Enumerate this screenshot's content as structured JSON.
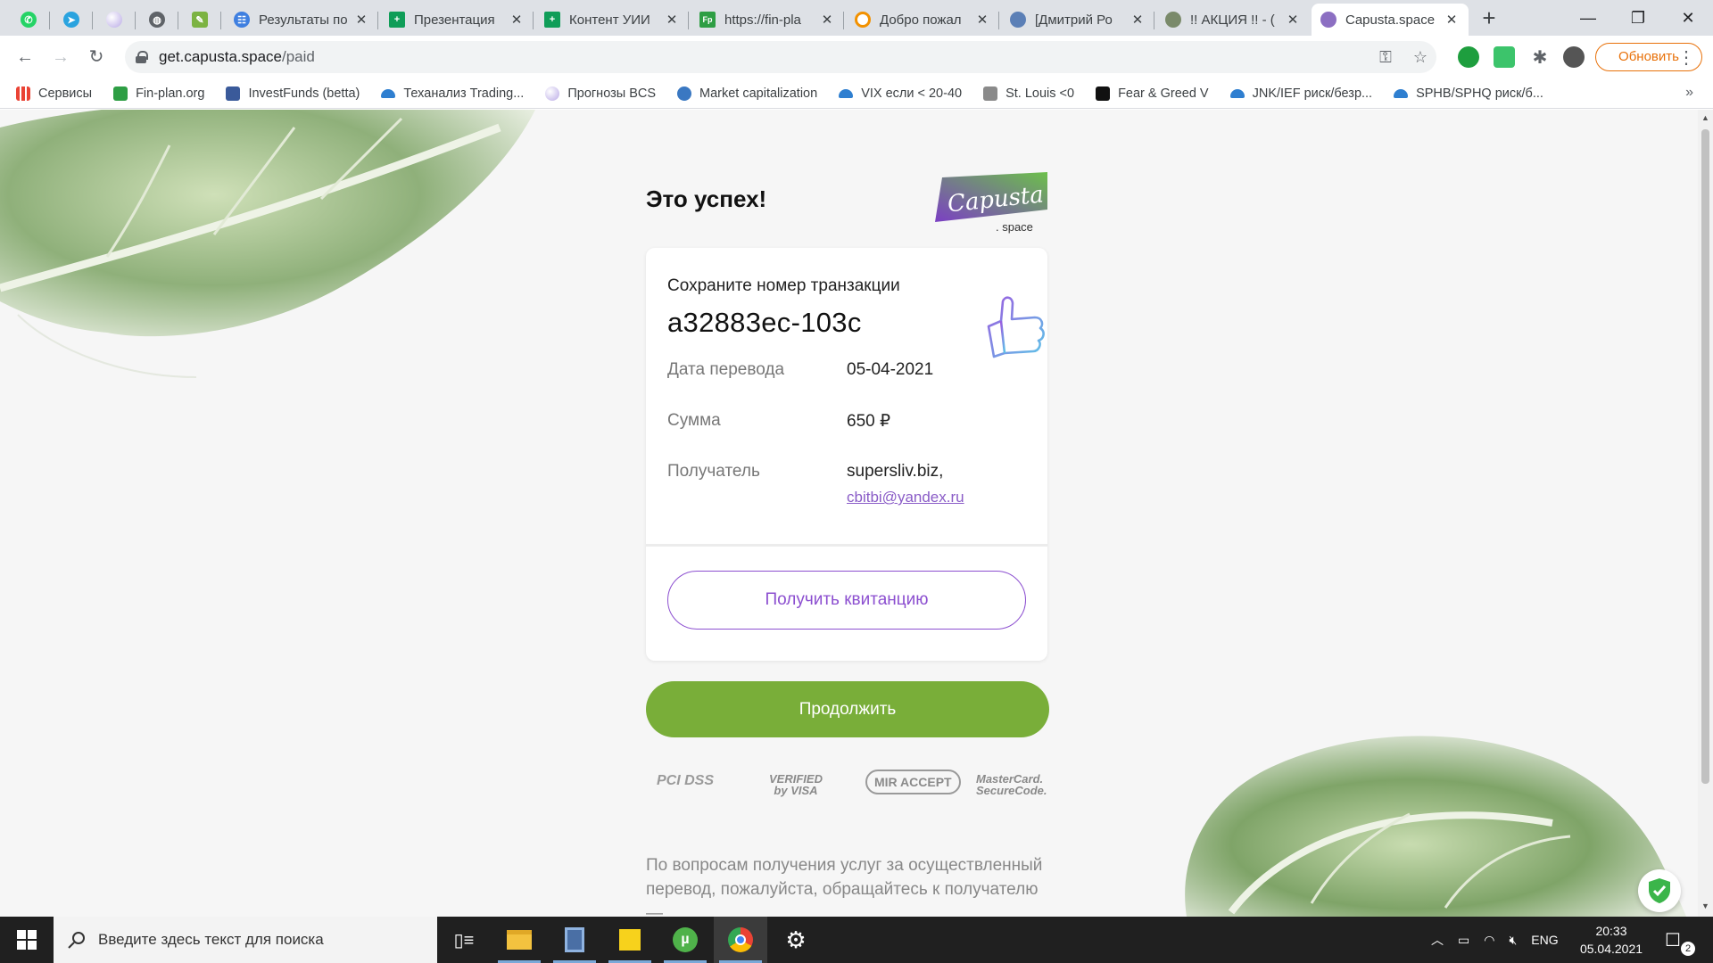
{
  "browser": {
    "tabs": [
      {
        "title": "",
        "favicon": "whatsapp-icon",
        "color": "#25d366",
        "pinned": true
      },
      {
        "title": "",
        "favicon": "telegram-icon",
        "color": "#2aa3df",
        "pinned": true
      },
      {
        "title": "",
        "favicon": "sphere-icon",
        "color": "#b9a9e6",
        "pinned": true
      },
      {
        "title": "",
        "favicon": "globe-icon",
        "color": "#5f6368",
        "pinned": true
      },
      {
        "title": "",
        "favicon": "pen-icon",
        "color": "#7cb342",
        "pinned": true
      },
      {
        "title": "Результаты по",
        "favicon": "forms-icon",
        "color": "#3f7fe0",
        "pinned": false
      },
      {
        "title": "Презентация",
        "favicon": "sheets-icon",
        "color": "#0f9d58",
        "pinned": false
      },
      {
        "title": "Контент УИИ",
        "favicon": "sheets-icon",
        "color": "#0f9d58",
        "pinned": false
      },
      {
        "title": "https://fin-pla",
        "favicon": "finplan-icon",
        "color": "#2e9e44",
        "pinned": false
      },
      {
        "title": "Добро пожал",
        "favicon": "co-icon",
        "color": "#f29100",
        "pinned": false
      },
      {
        "title": "[Дмитрий Ро",
        "favicon": "avatar-icon",
        "color": "#5b7fb6",
        "pinned": false
      },
      {
        "title": "!! АКЦИЯ !! - (",
        "favicon": "avatar-icon",
        "color": "#7a8a6a",
        "pinned": false
      },
      {
        "title": "Capusta.space",
        "favicon": "capusta-icon",
        "color": "#8c6fc2",
        "pinned": false,
        "active": true
      }
    ],
    "new_tab_symbol": "+",
    "window_controls": {
      "minimize": "—",
      "maximize": "❐",
      "close": "✕"
    },
    "url_host": "get.capusta.space",
    "url_path": "/paid",
    "update_button": "Обновить",
    "bookmarks": [
      {
        "label": "Сервисы",
        "icon": "apps-grid-icon",
        "color": "#ea4335"
      },
      {
        "label": "Fin-plan.org",
        "icon": "finplan-icon",
        "color": "#2e9e44"
      },
      {
        "label": "InvestFunds (betta)",
        "icon": "if-icon",
        "color": "#3a5a9a"
      },
      {
        "label": "Теханализ Trading...",
        "icon": "cloud-icon",
        "color": "#2f7fd0"
      },
      {
        "label": "Прогнозы BCS",
        "icon": "sphere-icon",
        "color": "#b9a9e6"
      },
      {
        "label": "Market capitalization",
        "icon": "globe-icon",
        "color": "#3a78c2"
      },
      {
        "label": "VIX если < 20-40",
        "icon": "cloud-icon",
        "color": "#2f7fd0"
      },
      {
        "label": "St. Louis <0",
        "icon": "chart-icon",
        "color": "#8a8a8a"
      },
      {
        "label": "Fear & Greed V",
        "icon": "fg-icon",
        "color": "#111111"
      },
      {
        "label": "JNK/IEF риск/безр...",
        "icon": "cloud-icon",
        "color": "#2f7fd0"
      },
      {
        "label": "SPHB/SPHQ риск/б...",
        "icon": "cloud-icon",
        "color": "#2f7fd0"
      }
    ],
    "bookmarks_more": "»"
  },
  "page": {
    "title": "Это успех!",
    "logo_main": "Capusta",
    "logo_sub": ". space",
    "card": {
      "header": "Сохраните номер транзакции",
      "transaction_id": "a32883ec-103c",
      "rows": [
        {
          "label": "Дата перевода",
          "value": "05-04-2021"
        },
        {
          "label": "Сумма",
          "value": "650 ₽"
        },
        {
          "label": "Получатель",
          "value": "supersliv.biz,"
        }
      ],
      "recipient_email": "cbitbi@yandex.ru",
      "receipt_button": "Получить квитанцию"
    },
    "continue_button": "Продолжить",
    "payment_logos": {
      "pci": "PCI DSS",
      "visa_top": "VERIFIED",
      "visa_bottom": "by VISA",
      "mir": "MIR ACCEPT",
      "mc_top": "MasterCard.",
      "mc_bottom": "SecureCode."
    },
    "footer_text": "По вопросам получения услуг за осуществленный перевод, пожалуйста, обращайтесь к получателю —",
    "colors": {
      "accent_purple": "#8c4fd0",
      "continue_green": "#79ae39"
    }
  },
  "taskbar": {
    "search_placeholder": "Введите здесь текст для поиска",
    "apps": [
      "task-view-icon",
      "file-explorer-icon",
      "calculator-icon",
      "sticky-notes-icon",
      "utorrent-icon",
      "chrome-icon",
      "settings-icon"
    ],
    "language": "ENG",
    "time": "20:33",
    "date": "05.04.2021",
    "notification_count": "2"
  }
}
